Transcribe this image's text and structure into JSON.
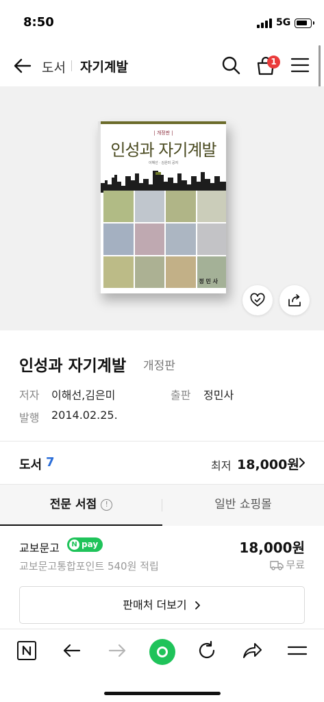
{
  "status_bar": {
    "time": "8:50",
    "network": "5G"
  },
  "header": {
    "breadcrumb_parent": "도서",
    "breadcrumb_current": "자기계발",
    "cart_count": "1"
  },
  "cover": {
    "edition_tag": "| 개정판 |",
    "title": "인성과 자기계발",
    "authors": "이해선 · 김은미 공저",
    "publisher": "정 민 사"
  },
  "book": {
    "title": "인성과 자기계발",
    "edition": "개정판",
    "author_label": "저자",
    "author_value": "이해선,김은미",
    "publisher_label": "출판",
    "publisher_value": "정민사",
    "date_label": "발행",
    "date_value": "2014.02.25."
  },
  "category": {
    "name": "도서",
    "count": "7",
    "min_label": "최저",
    "min_price": "18,000원"
  },
  "tabs": [
    {
      "label": "전문 서점"
    },
    {
      "label": "일반 쇼핑몰"
    }
  ],
  "seller": {
    "name": "교보문고",
    "pay_badge": "pay",
    "price": "18,000원",
    "points": "교보문고통합포인트 540원 적립",
    "shipping": "무료"
  },
  "more_button": {
    "label": "판매처 더보기"
  },
  "colors": {
    "accent_blue": "#2a6dd8",
    "naver_green": "#1fc35a",
    "badge_red": "#ea3b3b"
  }
}
